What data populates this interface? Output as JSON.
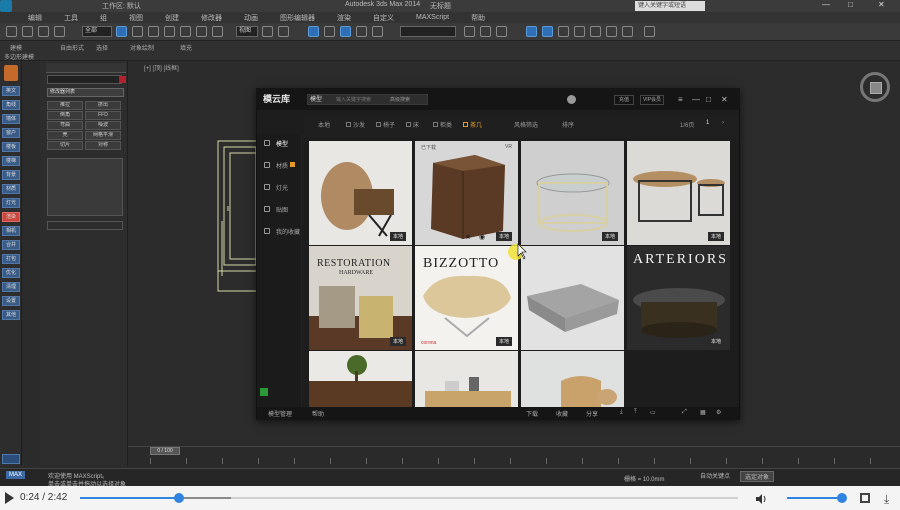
{
  "app": {
    "title": "Autodesk 3ds Max 2014",
    "file": "无标题",
    "search_placeholder": "键入关键字或短语",
    "menu": [
      "编辑",
      "工具",
      "组",
      "视图",
      "创建",
      "修改器",
      "动画",
      "图形编辑器",
      "渲染",
      "自定义",
      "MAXScript",
      "帮助"
    ],
    "workspace": "工作区: 默认",
    "toolbar_select": "全部",
    "toolbar_view": "视图"
  },
  "ribbon": {
    "tabs": [
      "建模",
      "自由形式",
      "选择",
      "对象绘制",
      "填充"
    ],
    "sub": "多边形建模"
  },
  "left_strip": [
    "英文",
    "角线",
    "墙体",
    "窗户",
    "楼板",
    "楼梯",
    "背景",
    "材质",
    "灯光",
    "渲染",
    "相机",
    "合并",
    "打包",
    "优化",
    "清理",
    "设置",
    "其他"
  ],
  "cmd_panel": {
    "modifier_list": "修改器列表",
    "buttons": [
      "推拉",
      "挤出",
      "倒角",
      "FFD",
      "弯曲",
      "噪波",
      "壳",
      "网格平滑",
      "切片",
      "对称"
    ]
  },
  "viewport": {
    "label": "[+] [顶] [线框]"
  },
  "timeline": {
    "slider": "0 / 100",
    "ticks": [
      "0",
      "5",
      "10",
      "15",
      "20",
      "25",
      "30",
      "35",
      "40",
      "45",
      "50",
      "55",
      "60",
      "65",
      "70",
      "75",
      "80",
      "85",
      "90",
      "95",
      "100"
    ]
  },
  "status": {
    "left": "欢迎使用 MAXScript。",
    "mid": "单击或单击并拖动以选择对象",
    "grid": "栅格 = 10.0mm",
    "auto": "自动关键点",
    "selected": "选定对象"
  },
  "plugin": {
    "brand": "模云库",
    "search_dropdown": "模型",
    "search_placeholder": "输入关键字搜索",
    "search_button": "高级搜索",
    "btn_recharge": "充值",
    "btn_vip": "VIP会员",
    "side": [
      {
        "label": "模型",
        "active": true
      },
      {
        "label": "材质",
        "badge": true
      },
      {
        "label": "灯光"
      },
      {
        "label": "贴图"
      },
      {
        "label": "我的收藏"
      }
    ],
    "filters": [
      {
        "label": "本地",
        "selected": false
      },
      {
        "label": "沙发",
        "selected": false
      },
      {
        "label": "椅子",
        "selected": false
      },
      {
        "label": "床",
        "selected": false
      },
      {
        "label": "柜类",
        "selected": false
      },
      {
        "label": "茶几",
        "selected": true
      },
      {
        "label": "风格筛选",
        "selected": false
      },
      {
        "label": "排序",
        "selected": false
      }
    ],
    "page": "1/6页",
    "page_num": "1",
    "tiles": [
      {
        "tag": "本地",
        "kind": "round-table"
      },
      {
        "tag": "本地",
        "kind": "wood-cube",
        "top_left": "已下载",
        "top_right": "VR"
      },
      {
        "tag": "本地",
        "kind": "glass-table"
      },
      {
        "tag": "本地",
        "kind": "metal-tables"
      },
      {
        "tag": "本地",
        "kind": "stumps",
        "brand1": "RESTORATION",
        "brand2": "HARDWARE"
      },
      {
        "tag": "本地",
        "kind": "slab",
        "brand": "BIZZOTTO",
        "corner": "corona"
      },
      {
        "tag": "",
        "kind": "concrete"
      },
      {
        "tag": "本地",
        "kind": "arteriors",
        "brand": "ARTERIORS"
      },
      {
        "tag": "",
        "kind": "plant"
      },
      {
        "tag": "",
        "kind": "sidetable"
      },
      {
        "tag": "",
        "kind": "ottoman"
      }
    ],
    "bottom": [
      "模型管理",
      "帮助",
      "下载",
      "收藏",
      "分享"
    ]
  },
  "video": {
    "time": "0:24 / 2:42",
    "progress": 0.15,
    "buffered": 0.08,
    "volume": 1.0
  }
}
